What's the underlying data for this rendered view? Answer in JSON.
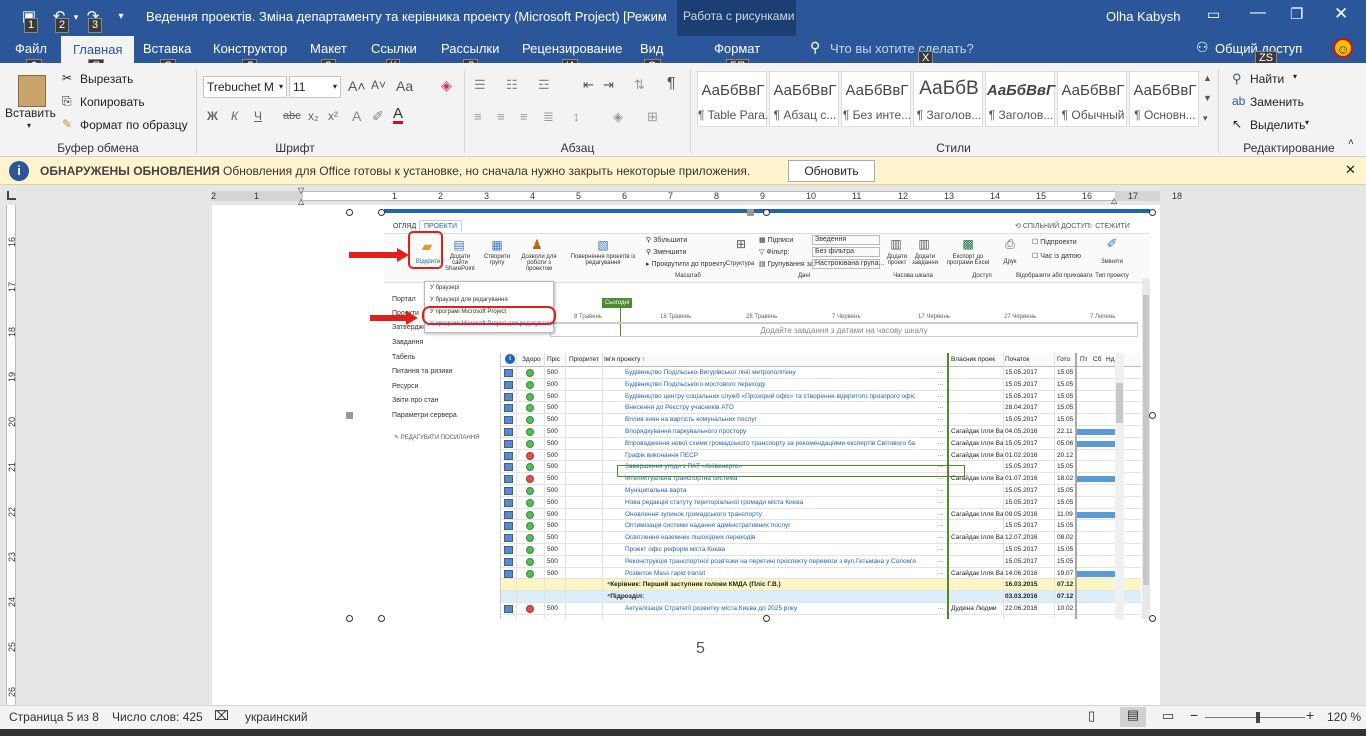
{
  "window": {
    "title": "Ведення проектів. Зміна департаменту та керівника проекту (Microsoft Project) [Режим огра...",
    "context_group": "Работа с рисунками",
    "user": "Olha Kabysh"
  },
  "qat": {
    "keytips": [
      "1",
      "2",
      "3"
    ]
  },
  "tabs": [
    {
      "label": "Файл",
      "key": "Ф"
    },
    {
      "label": "Главная",
      "key": "Я"
    },
    {
      "label": "Вставка",
      "key": "С"
    },
    {
      "label": "Конструктор",
      "key": "Д"
    },
    {
      "label": "Макет",
      "key": "З"
    },
    {
      "label": "Ссылки",
      "key": "К"
    },
    {
      "label": "Рассылки",
      "key": "Л"
    },
    {
      "label": "Рецензирование",
      "key": "И"
    },
    {
      "label": "Вид",
      "key": "О"
    },
    {
      "label": "Формат",
      "key": "БП"
    }
  ],
  "tellme": {
    "placeholder": "Что вы хотите сделать?",
    "key": "Х"
  },
  "share": {
    "label": "Общий доступ",
    "key": "ZS"
  },
  "clipboard": {
    "paste": "Вставить",
    "cut": "Вырезать",
    "copy": "Копировать",
    "format_painter": "Формат по образцу",
    "group": "Буфер обмена"
  },
  "font": {
    "name": "Trebuchet M",
    "size": "11",
    "group": "Шрифт",
    "bold": "Ж",
    "italic": "К",
    "underline": "Ч",
    "strike": "abc"
  },
  "paragraph": {
    "group": "Абзац"
  },
  "styles": {
    "group": "Стили",
    "items": [
      {
        "sample": "АаБбВвГ",
        "name": "¶ Table Para..."
      },
      {
        "sample": "АаБбВвГ",
        "name": "¶ Абзац с..."
      },
      {
        "sample": "АаБбВвГ",
        "name": "¶ Без инте..."
      },
      {
        "sample": "АаБбВ",
        "name": "¶ Заголов..."
      },
      {
        "sample": "АаБбВвГ",
        "name": "¶ Заголов..."
      },
      {
        "sample": "АаБбВвГ",
        "name": "¶ Обычный"
      },
      {
        "sample": "АаБбВвГ",
        "name": "¶ Основн..."
      }
    ]
  },
  "editing": {
    "find": "Найти",
    "replace": "Заменить",
    "select": "Выделить",
    "group": "Редактирование"
  },
  "infobar": {
    "title": "ОБНАРУЖЕНЫ ОБНОВЛЕНИЯ",
    "message": "Обновления для Office готовы к установке, но сначала нужно закрыть некоторые приложения.",
    "button": "Обновить"
  },
  "ruler": {
    "h_ticks": [
      "2",
      "1",
      "1",
      "2",
      "3",
      "4",
      "5",
      "6",
      "7",
      "8",
      "9",
      "10",
      "11",
      "12",
      "13",
      "14",
      "15",
      "16",
      "17",
      "18"
    ],
    "v_ticks": [
      "16",
      "17",
      "18",
      "19",
      "20",
      "21",
      "22",
      "23",
      "24",
      "25",
      "26"
    ]
  },
  "screenshot": {
    "tabs": [
      "ОГЛЯД",
      "ПРОЕКТИ"
    ],
    "share": "СПІЛЬНИЙ ДОСТУП",
    "follow": "СТЕЖИТИ",
    "ribbon_buttons": [
      "Відкрити",
      "Додати сайти SharePoint",
      "Створити групу",
      "Дозволи для роботи з проектом",
      "Повернення проектів із редагування",
      "Структура",
      "Додати проект",
      "Додати завдання",
      "Експорт до програми Excel",
      "Друк",
      "Змінити"
    ],
    "zoom_in": "Збільшити",
    "zoom_out": "Зменшити",
    "scroll_to": "Прокрутити до проекту",
    "scale_group": "Масштаб",
    "data_group": "Дані",
    "timescale_group": "Часова шкала",
    "access_group": "Доступ",
    "show_hide_group": "Відобразити або приховати",
    "project_type_group": "Тип проекту",
    "outline_label": "Підписи",
    "filter_label": "Фільтр:",
    "group_by_label": "Групування за:",
    "view_value": "Зведення",
    "filter_value": "Без фільтра",
    "group_value": "Настроювана група...",
    "subprojects": "Підпроекти",
    "time_with_date": "Час із датою",
    "menu": {
      "items": [
        "У браузері",
        "У браузері для редагування",
        "У програмі Microsoft Project",
        "У програмі Microsoft Project для редагування"
      ]
    },
    "nav": [
      "Портал",
      "Проекти",
      "Затвердження",
      "Завдання",
      "Табель",
      "Питання та ризики",
      "Ресурси",
      "Звіти про стан",
      "Параметри сервера"
    ],
    "edit_links": "РЕДАГУВАТИ ПОСИЛАННЯ",
    "today": "Сьогодні",
    "timeline_dates": [
      "8 Травень",
      "18 Травень",
      "28 Травень",
      "7 Червень",
      "17 Червень",
      "27 Червень",
      "7 Липень"
    ],
    "timeline_hint": "Додайте завдання з датами на часову шкалу",
    "columns": [
      "Здоро",
      "Пріс",
      "Пріоритет",
      "Ім'я проекту ↑",
      "Власник проек",
      "Початок",
      "Гото"
    ],
    "gantt_days": [
      "Пт",
      "Сб",
      "Нд"
    ],
    "rows": [
      {
        "health": "green",
        "pct": "500",
        "name": "Будівництво Подільсько-Вигурівської лінії метрополітену",
        "owner": "",
        "start": "15.05.2017",
        "finish": "15.05",
        "bar": false
      },
      {
        "health": "green",
        "pct": "500",
        "name": "Будівництво Подільського мостового переходу",
        "owner": "",
        "start": "15.05.2017",
        "finish": "15.05",
        "bar": false
      },
      {
        "health": "green",
        "pct": "500",
        "name": "Будівництво центру соціальних служб «Прозорий офіс» та створення відкритого прозорого офіс",
        "owner": "",
        "start": "15.05.2017",
        "finish": "15.05",
        "bar": false
      },
      {
        "health": "green",
        "pct": "500",
        "name": "Внесення до Реєстру учасників АТО",
        "owner": "",
        "start": "28.04.2017",
        "finish": "15.05",
        "bar": false
      },
      {
        "health": "green",
        "pct": "500",
        "name": "Вплив киян на вартість комунальних послуг",
        "owner": "",
        "start": "15.05.2017",
        "finish": "15.05",
        "bar": false
      },
      {
        "health": "green",
        "pct": "500",
        "name": "Впорядкування паркувального простору",
        "owner": "Сагайдак Ілля Ва",
        "start": "04.05.2016",
        "finish": "22.11",
        "bar": true
      },
      {
        "health": "green",
        "pct": "500",
        "name": "Впровадження нової схеми громадського транспорту за рекомендаціями експертів Світового ба",
        "owner": "Сагайдак Ілля Ва",
        "start": "15.05.2017",
        "finish": "05.06",
        "bar": true
      },
      {
        "health": "red",
        "pct": "500",
        "name": "Графік виконання ПЕСР",
        "owner": "Сагайдак Ілля Ва",
        "start": "01.02.2016",
        "finish": "20.12",
        "bar": false
      },
      {
        "health": "green",
        "pct": "500",
        "name": "Завершення угоди з ПАТ «Київенерго»",
        "owner": "",
        "start": "15.05.2017",
        "finish": "15.05",
        "bar": false
      },
      {
        "health": "red",
        "pct": "500",
        "name": "Інтелектуальна транспортна система",
        "owner": "Сагайдак Ілля Ва",
        "start": "01.07.2016",
        "finish": "18.02",
        "bar": true
      },
      {
        "health": "green",
        "pct": "500",
        "name": "Муніципальна варта",
        "owner": "",
        "start": "15.05.2017",
        "finish": "15.05",
        "bar": false
      },
      {
        "health": "green",
        "pct": "500",
        "name": "Нова редакція статуту територіальної громади міста Києва",
        "owner": "",
        "start": "15.05.2017",
        "finish": "15.05",
        "bar": false
      },
      {
        "health": "green",
        "pct": "500",
        "name": "Оновлення зупинок громадського транспорту",
        "owner": "Сагайдак Ілля Ва",
        "start": "09.05.2016",
        "finish": "11.09",
        "bar": true
      },
      {
        "health": "green",
        "pct": "500",
        "name": "Оптимізація системи надання адміністративних послуг",
        "owner": "",
        "start": "15.05.2017",
        "finish": "15.05",
        "bar": false
      },
      {
        "health": "green",
        "pct": "500",
        "name": "Освітлення наземних пішохідних переходів",
        "owner": "Сагайдак Ілля Ва",
        "start": "12.07.2016",
        "finish": "08.02",
        "bar": false
      },
      {
        "health": "green",
        "pct": "500",
        "name": "Проект офіс реформ міста Києва",
        "owner": "",
        "start": "15.05.2017",
        "finish": "15.05",
        "bar": false
      },
      {
        "health": "green",
        "pct": "500",
        "name": "Реконструкція транспортної розв'язки на перетині проспекту перемоги з вул.Гетьмана у Солом'я",
        "owner": "",
        "start": "15.05.2017",
        "finish": "15.05",
        "bar": false
      },
      {
        "health": "green",
        "pct": "500",
        "name": "Розвиток Mass rapid transit",
        "owner": "Сагайдак Ілля Ва",
        "start": "14.06.2016",
        "finish": "19.07",
        "bar": true
      }
    ],
    "group1": {
      "name": "⁴Керівник: Перший заступник голови КМДА (Пліс Г.В.)",
      "start": "16.03.2015",
      "finish": "07.12"
    },
    "group2": {
      "name": "⁴Підрозділ:",
      "start": "03.03.2016",
      "finish": "07.12"
    },
    "last_row": {
      "health": "red",
      "pct": "500",
      "name": "Актуалізація Стратегії розвитку міста Києва до 2025 року",
      "owner": "Дудкіна Людми",
      "start": "22.06.2016",
      "finish": "10.02"
    }
  },
  "page_number": "5",
  "status": {
    "page": "Страница 5 из 8",
    "words": "Число слов: 425",
    "language": "украинский",
    "zoom": "120 %"
  },
  "colors": {
    "word_blue": "#2b579a",
    "context_blue": "#1c3f73",
    "info_yellow": "#fff4ce",
    "red_arrow": "#e0201b",
    "ps_green": "#4e8a2e",
    "gantt_bar": "#5b9bd5"
  }
}
